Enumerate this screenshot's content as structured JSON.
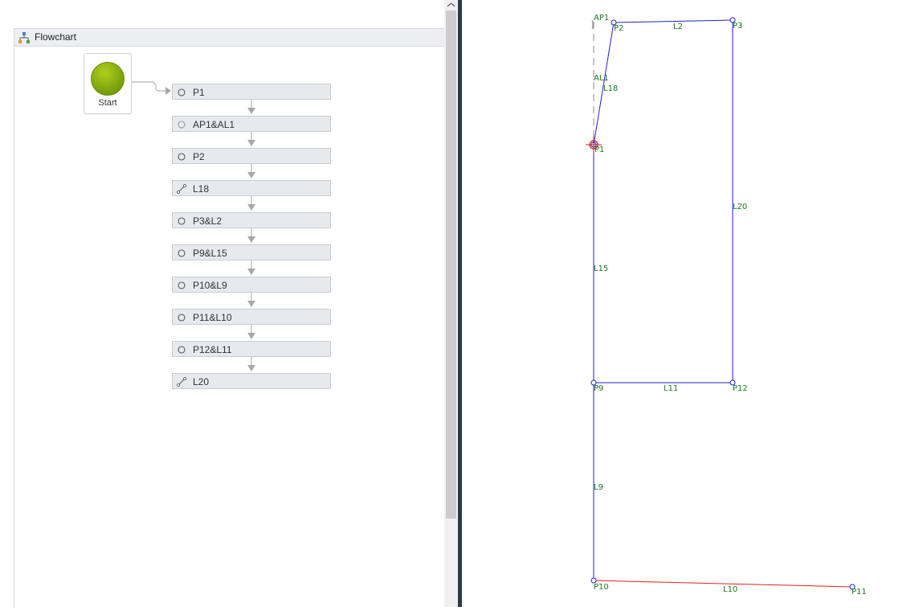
{
  "flowchart": {
    "title": "Flowchart",
    "start_label": "Start",
    "activities": [
      {
        "label": "P1",
        "icon": "point-circle-icon"
      },
      {
        "label": "AP1&AL1",
        "icon": "point-circle-icon"
      },
      {
        "label": "P2",
        "icon": "point-circle-icon"
      },
      {
        "label": "L18",
        "icon": "line-segment-icon"
      },
      {
        "label": "P3&L2",
        "icon": "point-circle-icon"
      },
      {
        "label": "P9&L15",
        "icon": "point-circle-icon"
      },
      {
        "label": "P10&L9",
        "icon": "point-circle-icon"
      },
      {
        "label": "P11&L10",
        "icon": "point-circle-icon"
      },
      {
        "label": "P12&L11",
        "icon": "point-circle-icon"
      },
      {
        "label": "L20",
        "icon": "line-segment-icon"
      }
    ]
  },
  "canvas": {
    "colors": {
      "line": "#1f1fd6",
      "selected_line": "#e02020",
      "label": "#1a7a1a",
      "marker": "#d01818",
      "construction": "#888888"
    },
    "point_labels": {
      "ap1": "AP1",
      "p1": "P1",
      "p2": "P2",
      "p3": "P3",
      "p9": "P9",
      "p10": "P10",
      "p11": "P11",
      "p12": "P12"
    },
    "line_labels": {
      "al1": "AL1",
      "l2": "L2",
      "l9": "L9",
      "l10": "L10",
      "l11": "L11",
      "l15": "L15",
      "l18": "L18",
      "l20": "L20"
    }
  }
}
